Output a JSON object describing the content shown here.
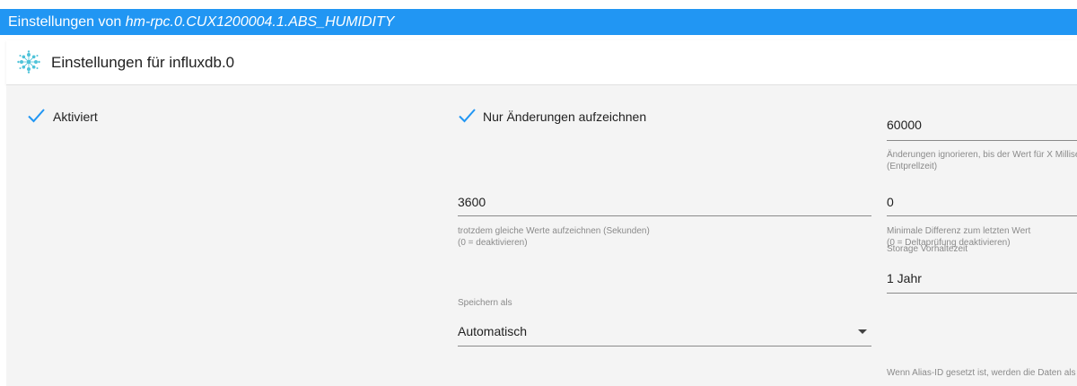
{
  "window": {
    "title_prefix": "Einstellungen von ",
    "title_object_id": "hm-rpc.0.CUX1200004.1.ABS_HUMIDITY"
  },
  "header": {
    "title": "Einstellungen für influxdb.0",
    "icon": "influxdb-adapter-icon"
  },
  "settings": {
    "enabled": {
      "label": "Aktiviert",
      "checked": true
    },
    "changes_only": {
      "label": "Nur Änderungen aufzeichnen",
      "checked": true
    },
    "debounce": {
      "value": "60000",
      "helper_line1": "Änderungen ignorieren, bis der Wert für X Millise",
      "helper_line2": "(Entprellzeit)"
    },
    "still_record": {
      "value": "3600",
      "helper_line1": "trotzdem gleiche Werte aufzeichnen (Sekunden)",
      "helper_line2": "(0 = deaktivieren)"
    },
    "min_difference": {
      "value": "0",
      "helper_line1": "Minimale Differenz zum letzten Wert",
      "helper_line2": "(0 = Deltaprüfung deaktivieren)"
    },
    "retention": {
      "label": "Storage Vorhaltezeit",
      "value": "1 Jahr"
    },
    "store_as": {
      "label": "Speichern als",
      "value": "Automatisch"
    },
    "alias_helper": "Wenn Alias-ID gesetzt ist, werden die Daten als a"
  },
  "colors": {
    "accent": "#2196f3",
    "background": "#f4f4f4",
    "checkmark": "#2196f3"
  }
}
